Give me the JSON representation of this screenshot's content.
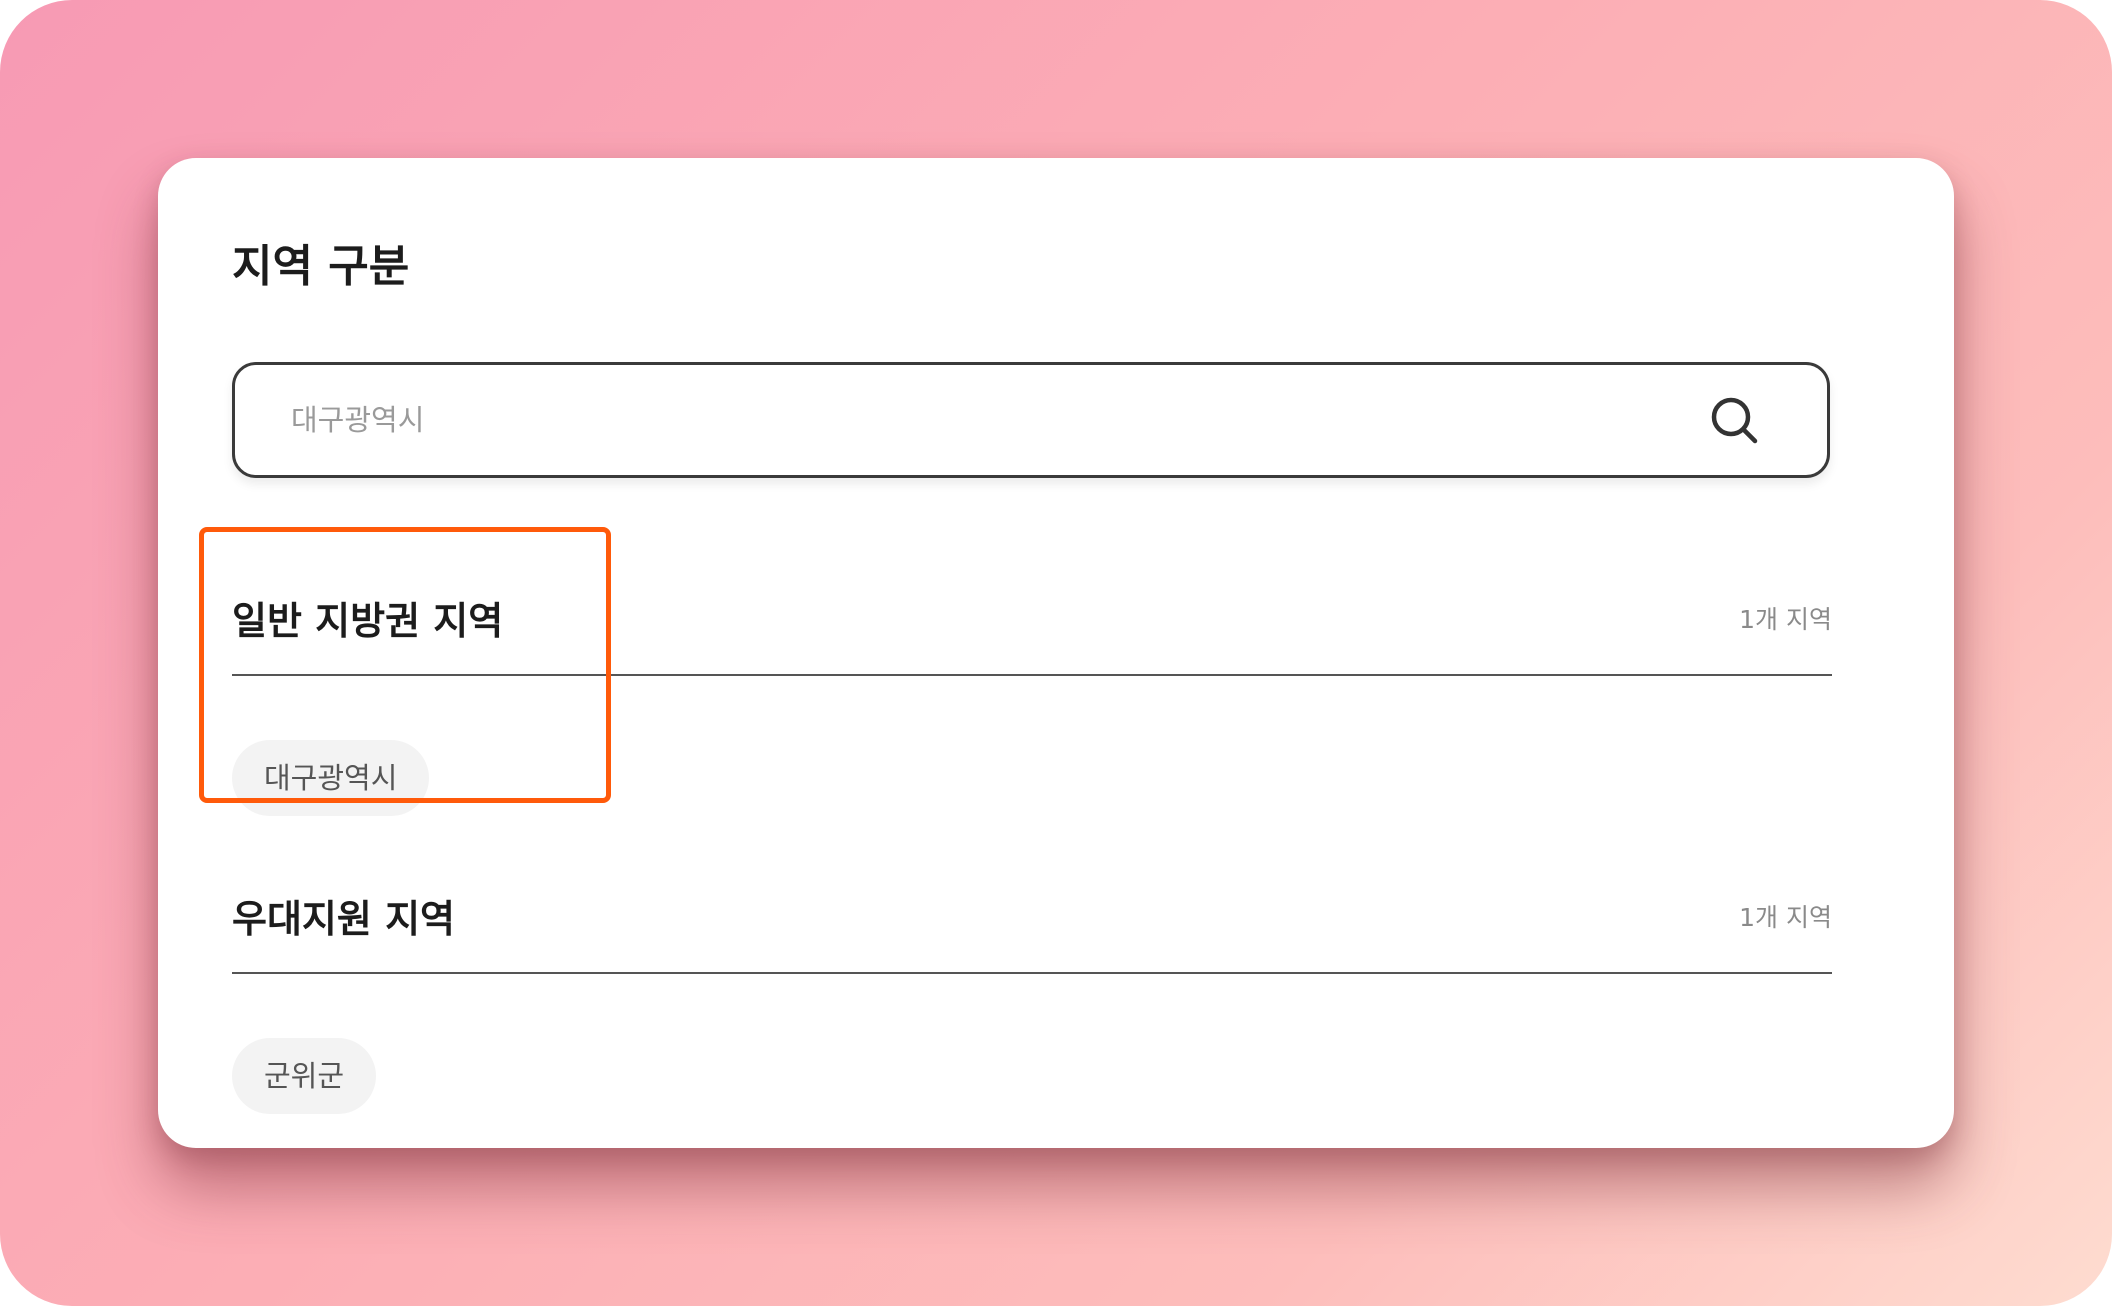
{
  "panel": {
    "title": "지역 구분"
  },
  "search": {
    "placeholder": "대구광역시",
    "value": "",
    "icon": "search-icon"
  },
  "sections": [
    {
      "title": "일반 지방권 지역",
      "count": "1개 지역",
      "chips": [
        "대구광역시"
      ]
    },
    {
      "title": "우대지원 지역",
      "count": "1개 지역",
      "chips": [
        "군위군"
      ]
    }
  ],
  "colors": {
    "highlight": "#ff5a0a",
    "chip_bg": "#f3f3f3",
    "text_primary": "#1c1c1c",
    "text_muted": "#8a8a8a"
  }
}
